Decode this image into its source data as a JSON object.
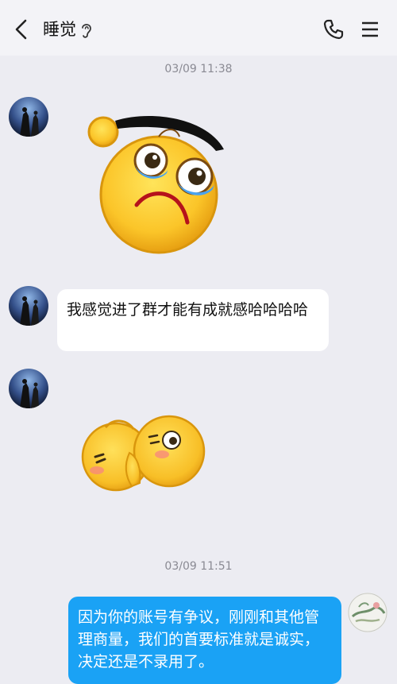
{
  "header": {
    "title": "睡觉",
    "icons": [
      "back-icon",
      "ear-icon",
      "phone-icon",
      "menu-icon"
    ]
  },
  "messages": {
    "timestamp_1": "03/09 11:38",
    "sticker_1": "crying-face-sticker",
    "text_1": "我感觉进了群才能有成就感哈哈哈哈",
    "sticker_2": "hugging-faces-sticker",
    "timestamp_2": "03/09 11:51",
    "text_2": "因为你的账号有争议，刚刚和其他管理商量，我们的首要标准就是诚实，决定还是不录用了。"
  },
  "colors": {
    "background": "#ececf2",
    "header": "#f3f3f7",
    "outgoing_bubble": "#1aa2f5",
    "incoming_bubble": "#ffffff"
  }
}
